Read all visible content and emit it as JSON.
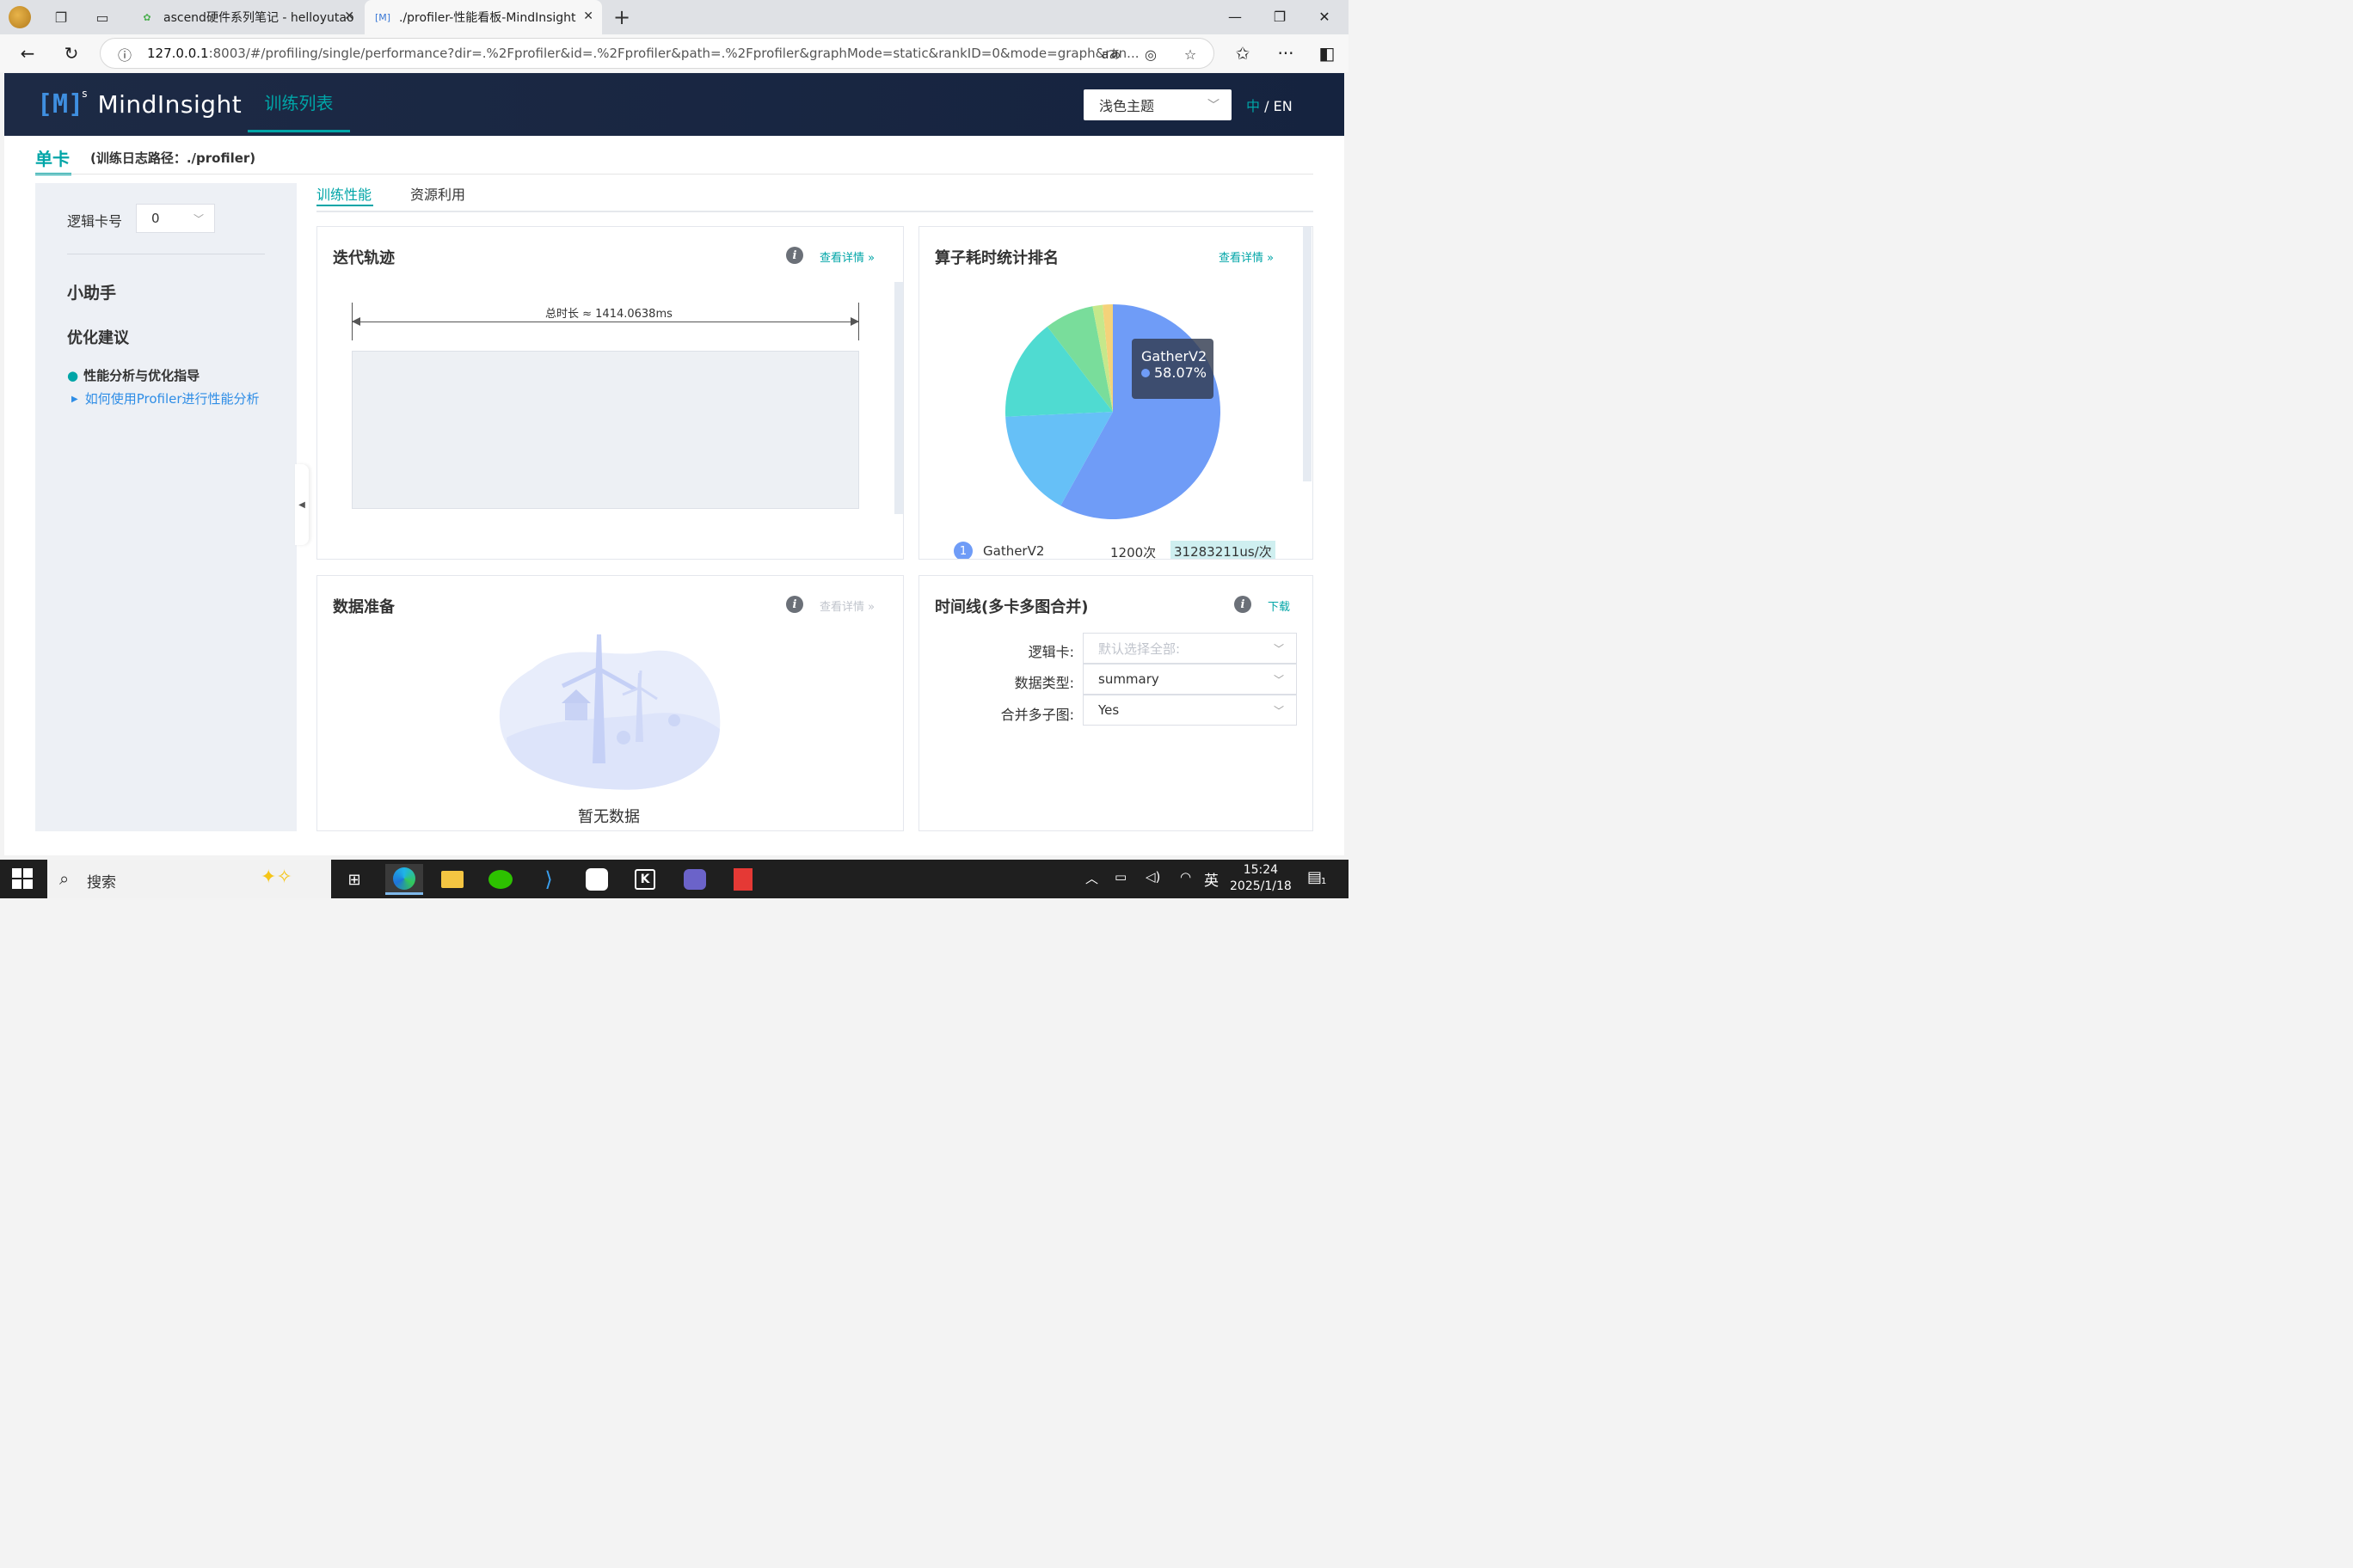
{
  "browser": {
    "tabs": [
      {
        "title": "ascend硬件系列笔记 - helloyutao",
        "active": false
      },
      {
        "title": "./profiler-性能看板-MindInsight",
        "active": true
      }
    ],
    "url_host": "127.0.0.1",
    "url_rest": ":8003/#/profiling/single/performance?dir=.%2Fprofiler&id=.%2Fprofiler&path=.%2Fprofiler&graphMode=static&rankID=0&mode=graph&ran..."
  },
  "header": {
    "logo_bracket": "[M]",
    "logo_sup": "s",
    "logo_name": "MindInsight",
    "nav_train": "训练列表",
    "theme": "浅色主题",
    "lang_zh": "中",
    "lang_sep": " / ",
    "lang_en": "EN"
  },
  "page": {
    "card_title": "单卡",
    "card_path": "(训练日志路径：./profiler)"
  },
  "left_panel": {
    "rank_label": "逻辑卡号",
    "rank_value": "0",
    "helper_title": "小助手",
    "suggest_title": "优化建议",
    "item1": "性能分析与优化指导",
    "item2": "如何使用Profiler进行性能分析"
  },
  "subtabs": {
    "perf": "训练性能",
    "resource": "资源利用"
  },
  "iteration": {
    "title": "迭代轨迹",
    "detail": "查看详情 »",
    "total_label": "总时长 ≈ 1414.0638ms"
  },
  "operator": {
    "title": "算子耗时统计排名",
    "detail": "查看详情 »",
    "tooltip_name": "GatherV2",
    "tooltip_value": "58.07%",
    "rank": "1",
    "top_name": "GatherV2",
    "top_count": "1200次",
    "top_time": "31283211us/次"
  },
  "chart_data": {
    "type": "pie",
    "slices": [
      {
        "label": "GatherV2",
        "value": 58.07,
        "color": "#6f9cf7"
      },
      {
        "label": "",
        "value": 16.2,
        "color": "#66c0f7"
      },
      {
        "label": "",
        "value": 15.3,
        "color": "#4fdbd1"
      },
      {
        "label": "",
        "value": 7.4,
        "color": "#79dd9b"
      },
      {
        "label": "",
        "value": 1.5,
        "color": "#c6e88b"
      },
      {
        "label": "",
        "value": 1.53,
        "color": "#f4d27a"
      }
    ]
  },
  "data_prep": {
    "title": "数据准备",
    "detail": "查看详情 »",
    "empty": "暂无数据"
  },
  "timeline": {
    "title": "时间线(多卡多图合并)",
    "download": "下载",
    "rank_label": "逻辑卡:",
    "rank_placeholder": "默认选择全部:",
    "type_label": "数据类型:",
    "type_value": "summary",
    "merge_label": "合并多子图:",
    "merge_value": "Yes"
  },
  "taskbar": {
    "search": "搜索",
    "ime": "英",
    "time": "15:24",
    "date": "2025/1/18",
    "notif": "1"
  }
}
